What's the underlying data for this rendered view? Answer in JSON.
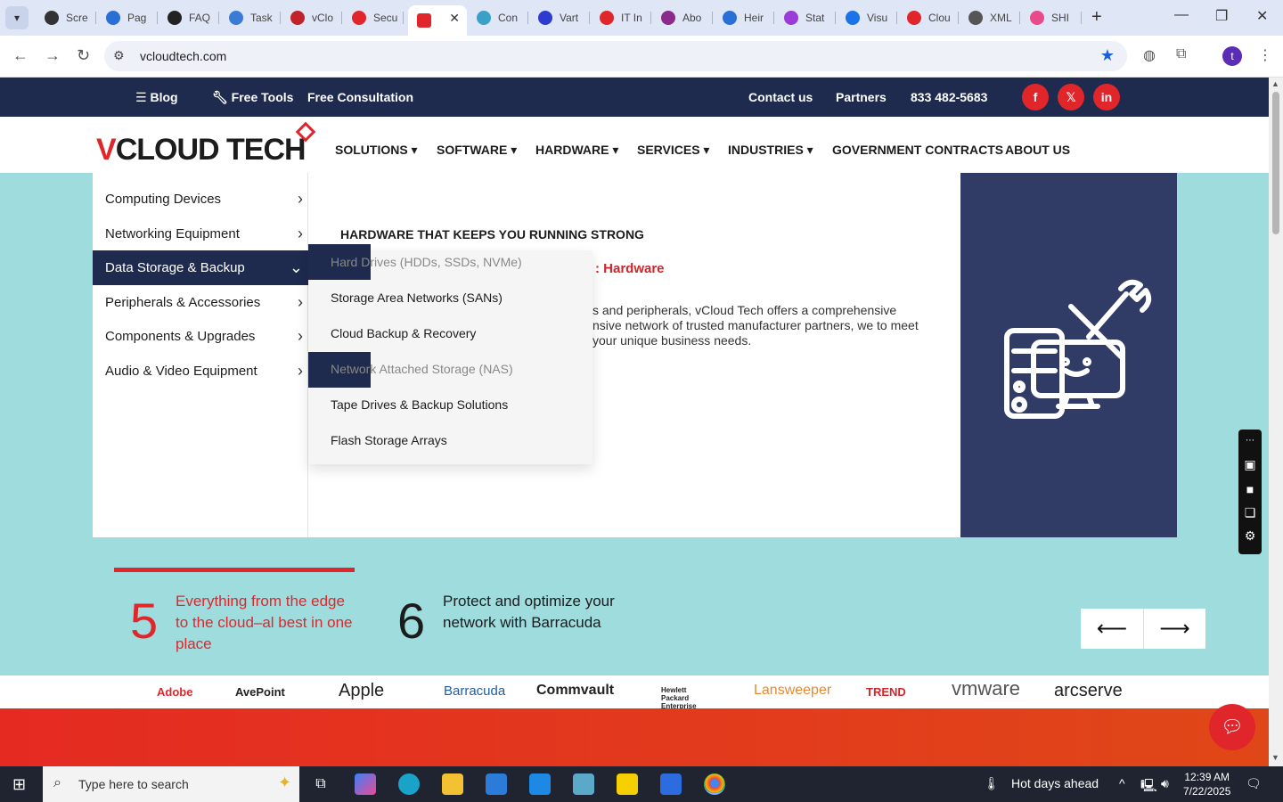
{
  "browser": {
    "tabs": [
      {
        "label": "Scre",
        "color": "#333333"
      },
      {
        "label": "Pag",
        "color": "#2a6fd6"
      },
      {
        "label": "FAQ",
        "color": "#222222"
      },
      {
        "label": "Task",
        "color": "#3a7bd5"
      },
      {
        "label": "vClo",
        "color": "#c0232a"
      },
      {
        "label": "Secu",
        "color": "#e0262b"
      },
      {
        "label": "Con",
        "color": "#3aa0c8"
      },
      {
        "label": "Vart",
        "color": "#2d3ccf"
      },
      {
        "label": "IT In",
        "color": "#e0262b"
      },
      {
        "label": "Abo",
        "color": "#8a2a8a"
      },
      {
        "label": "Heir",
        "color": "#2a6fd6"
      },
      {
        "label": "Stat",
        "color": "#9b3bd8"
      },
      {
        "label": "Visu",
        "color": "#1a73e8"
      },
      {
        "label": "Clou",
        "color": "#e0262b"
      },
      {
        "label": "XML",
        "color": "#555555"
      },
      {
        "label": "SHI",
        "color": "#e94a8a"
      }
    ],
    "active_tab_index": 6,
    "url": "vcloudtech.com",
    "profile_initial": "t"
  },
  "topbar": {
    "blog": "Blog",
    "free_tools": "Free Tools",
    "free_consultation": "Free Consultation",
    "contact": "Contact us",
    "partners": "Partners",
    "phone": "833 482-5683",
    "social": [
      "f",
      "𝕏",
      "in"
    ]
  },
  "logo": {
    "v": "V",
    "rest": "CLOUD TECH"
  },
  "nav": [
    "SOLUTIONS",
    "SOFTWARE",
    "HARDWARE",
    "SERVICES",
    "INDUSTRIES",
    "GOVERNMENT CONTRACTS",
    "ABOUT US"
  ],
  "mega": {
    "categories": [
      "Computing Devices",
      "Networking Equipment",
      "Data Storage & Backup",
      "Peripherals & Accessories",
      "Components & Upgrades",
      "Audio & Video Equipment"
    ],
    "active_category": 2,
    "heading": "HARDWARE THAT KEEPS YOU RUNNING STRONG",
    "sub": ": Hardware",
    "desc": "s and peripherals, vCloud Tech offers a comprehensive nsive network of trusted manufacturer partners, we to meet your unique business needs.",
    "submenu": [
      "Hard Drives (HDDs, SSDs, NVMe)",
      "Storage Area Networks (SANs)",
      "Cloud Backup & Recovery",
      "Network Attached Storage (NAS)",
      "Tape Drives & Backup Solutions",
      "Flash Storage Arrays"
    ]
  },
  "stats": [
    {
      "num": "5",
      "text": "Everything from the edge to the cloud–al best in one place",
      "color": "#e0262b"
    },
    {
      "num": "6",
      "text": "Protect and optimize your network with Barracuda",
      "color": "#1c1c1c"
    }
  ],
  "carousel": {
    "prev": "⟵",
    "next": "⟶"
  },
  "brands": [
    "Adobe",
    "AvePoint",
    "Apple",
    "Barracuda",
    "Commvault",
    "Hewlett Packard Enterprise",
    "Lansweeper",
    "TREND",
    "vmware",
    "arcserve"
  ],
  "taskbar": {
    "search_placeholder": "Type here to search",
    "weather": "Hot days ahead",
    "time": "12:39 AM",
    "date": "7/22/2025"
  }
}
